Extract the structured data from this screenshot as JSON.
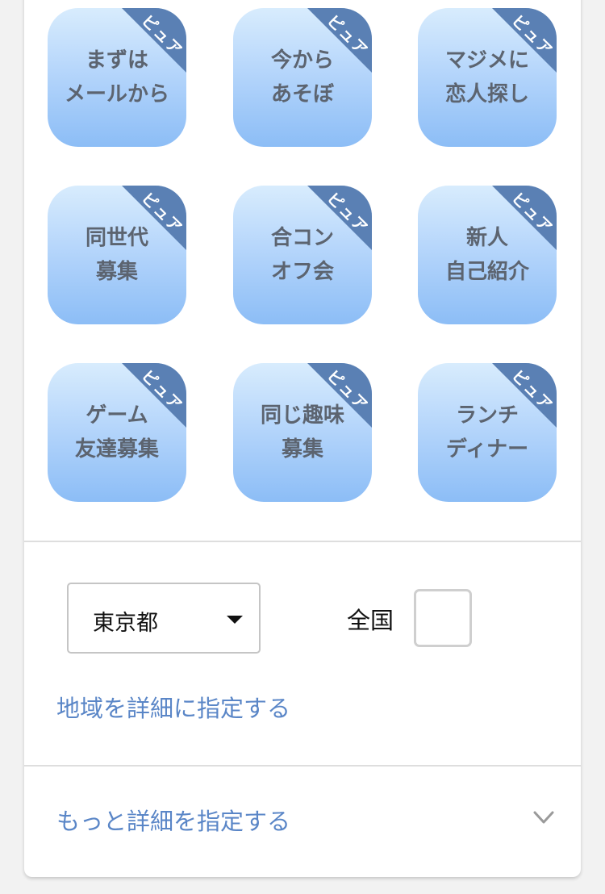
{
  "tiles": [
    {
      "label": "まずは\nメールから",
      "badge": "ピュア"
    },
    {
      "label": "今から\nあそぼ",
      "badge": "ピュア"
    },
    {
      "label": "マジメに\n恋人探し",
      "badge": "ピュア"
    },
    {
      "label": "同世代\n募集",
      "badge": "ピュア"
    },
    {
      "label": "合コン\nオフ会",
      "badge": "ピュア"
    },
    {
      "label": "新人\n自己紹介",
      "badge": "ピュア"
    },
    {
      "label": "ゲーム\n友達募集",
      "badge": "ピュア"
    },
    {
      "label": "同じ趣味\n募集",
      "badge": "ピュア"
    },
    {
      "label": "ランチ\nディナー",
      "badge": "ピュア"
    }
  ],
  "region": {
    "selected_prefecture": "東京都",
    "nationwide_label": "全国",
    "nationwide_checked": false,
    "detail_link": "地域を詳細に指定する"
  },
  "more_options": {
    "label": "もっと詳細を指定する",
    "icon": "chevron-down-icon"
  },
  "colors": {
    "tile_gradient_top": "#d8ecfd",
    "tile_gradient_bottom": "#8cbdf6",
    "badge": "#5a80b4",
    "link": "#5a86c7"
  }
}
